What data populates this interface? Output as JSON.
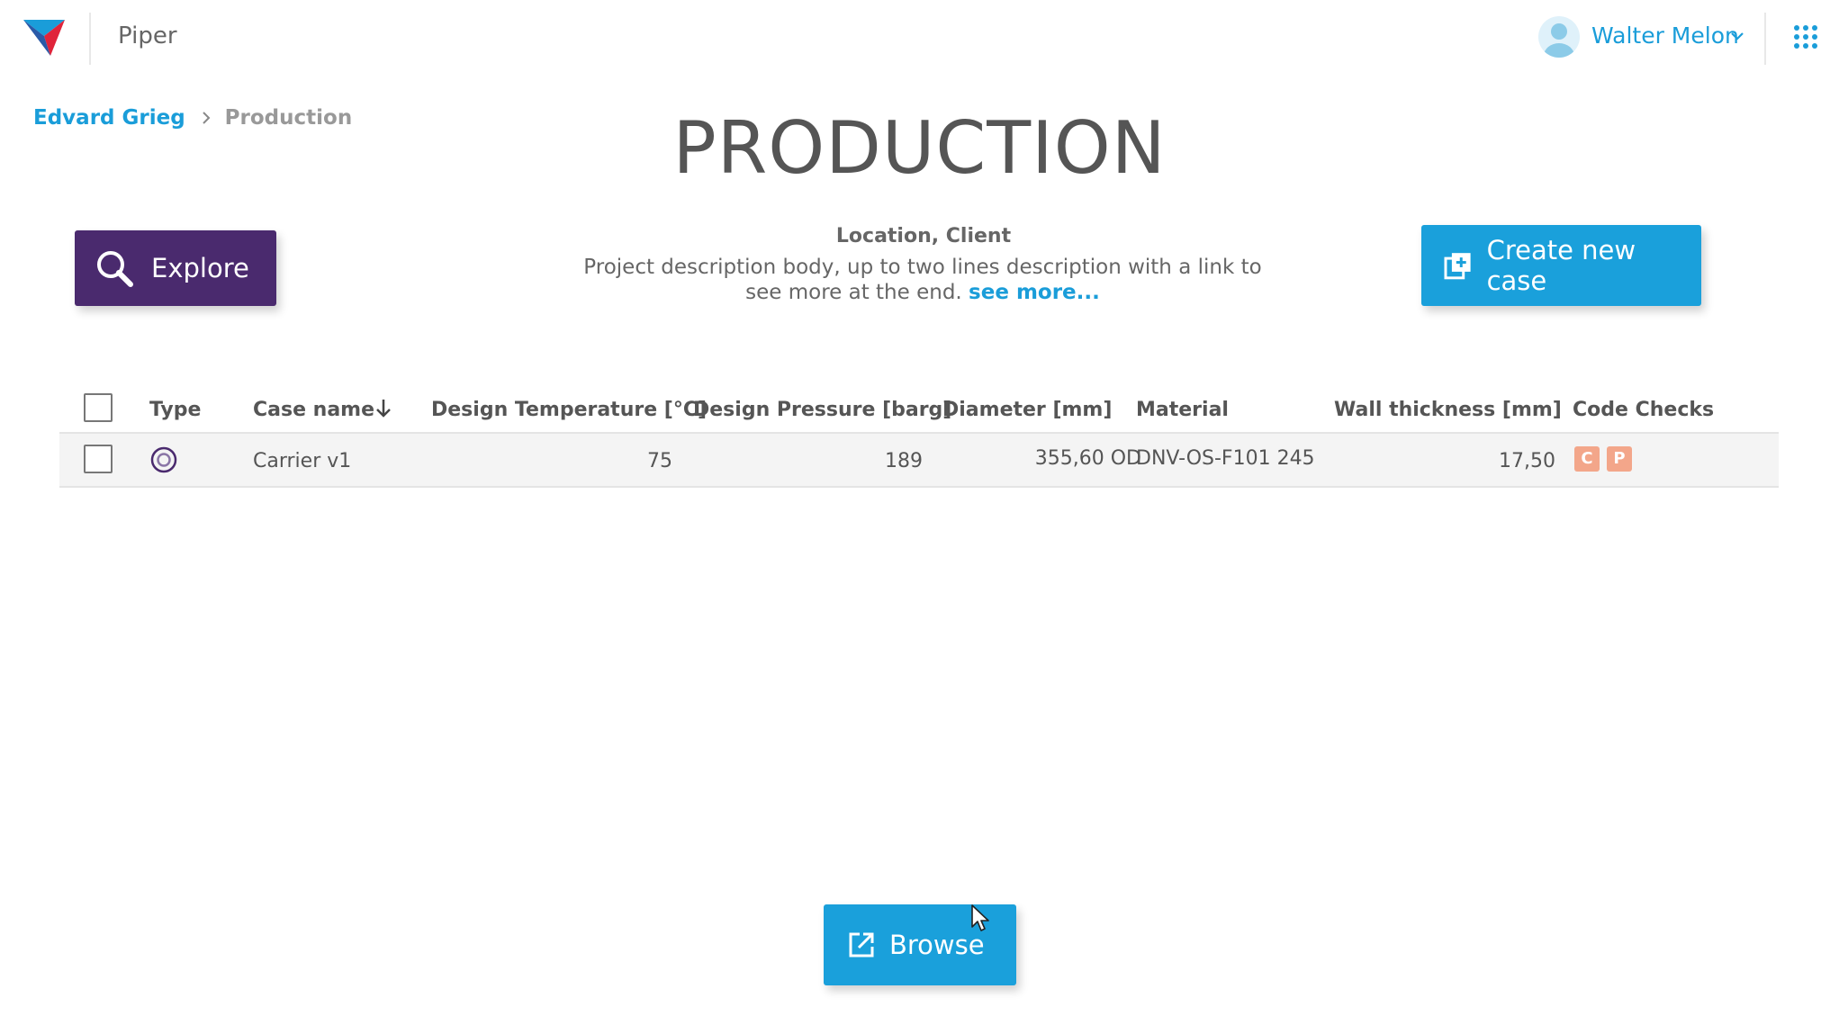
{
  "app": {
    "name": "Piper"
  },
  "user": {
    "name": "Walter Melon"
  },
  "breadcrumb": {
    "parent": "Edvard Grieg",
    "current": "Production"
  },
  "page": {
    "title": "PRODUCTION",
    "location": "Location, Client",
    "description": "Project description body, up to two lines description with a link to see more at the end.",
    "see_more": "see more..."
  },
  "buttons": {
    "explore": "Explore",
    "create_case": "Create new case",
    "browse": "Browse"
  },
  "table": {
    "columns": {
      "type": "Type",
      "case_name": "Case name",
      "design_temp": "Design Temperature [°C]",
      "design_pressure": "Design Pressure [barg]",
      "diameter": "Diameter [mm]",
      "material": "Material",
      "wall_thickness": "Wall thickness [mm]",
      "code_checks": "Code Checks"
    },
    "rows": [
      {
        "case_name": "Carrier v1",
        "design_temp": "75",
        "design_pressure": "189",
        "diameter": "355,60 OD",
        "material": "DNV-OS-F101 245",
        "wall_thickness": "17,50",
        "checks": [
          "C",
          "P"
        ]
      }
    ]
  },
  "colors": {
    "accent": "#1aa0db",
    "explore": "#4a2a6e",
    "badge": "#f3a68a"
  }
}
